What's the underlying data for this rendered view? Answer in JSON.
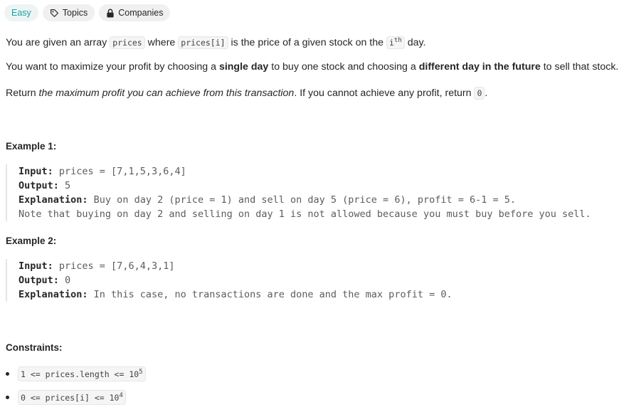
{
  "tags": {
    "difficulty": "Easy",
    "topics": "Topics",
    "companies": "Companies"
  },
  "desc": {
    "p1": {
      "t1": "You are given an array ",
      "c1": "prices",
      "t2": " where ",
      "c2": "prices[i]",
      "t3": " is the price of a given stock on the ",
      "c3": "i",
      "sup": "th",
      "t4": " day."
    },
    "p2": {
      "t1": "You want to maximize your profit by choosing a ",
      "b1": "single day",
      "t2": " to buy one stock and choosing a ",
      "b2": "different day in the future",
      "t3": " to sell that stock."
    },
    "p3": {
      "t1": "Return ",
      "i1": "the maximum profit you can achieve from this transaction",
      "t2": ". If you cannot achieve any profit, return ",
      "c1": "0",
      "t3": "."
    }
  },
  "example1": {
    "heading": "Example 1:",
    "input_label": "Input:",
    "input_value": " prices = [7,1,5,3,6,4]",
    "output_label": "Output:",
    "output_value": " 5",
    "explanation_label": "Explanation:",
    "explanation_value": " Buy on day 2 (price = 1) and sell on day 5 (price = 6), profit = 6-1 = 5.",
    "note": "Note that buying on day 2 and selling on day 1 is not allowed because you must buy before you sell."
  },
  "example2": {
    "heading": "Example 2:",
    "input_label": "Input:",
    "input_value": " prices = [7,6,4,3,1]",
    "output_label": "Output:",
    "output_value": " 0",
    "explanation_label": "Explanation:",
    "explanation_value": " In this case, no transactions are done and the max profit = 0."
  },
  "constraints": {
    "heading": "Constraints:",
    "c1": {
      "text": "1 <= prices.length <= 10",
      "sup": "5"
    },
    "c2": {
      "text": "0 <= prices[i] <= 10",
      "sup": "4"
    }
  }
}
